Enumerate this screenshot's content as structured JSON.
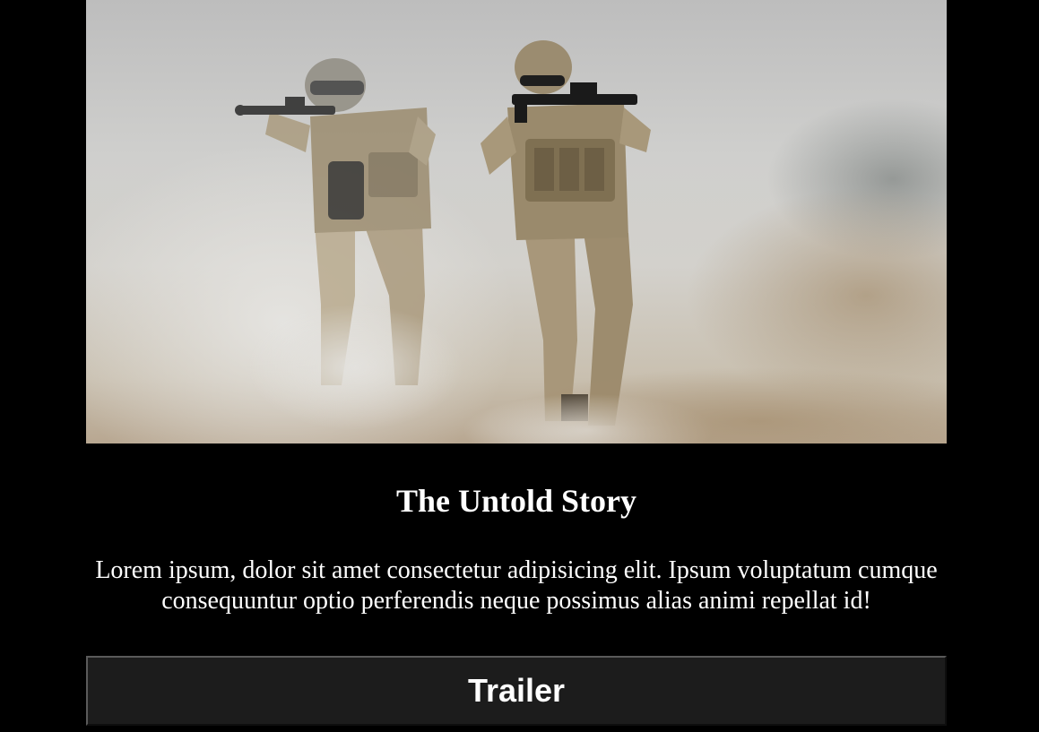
{
  "hero": {
    "image_subject": "two-soldiers-in-smoke-photo"
  },
  "title": "The Untold Story",
  "description": "Lorem ipsum, dolor sit amet consectetur adipisicing elit. Ipsum voluptatum cumque consequuntur optio perferendis neque possimus alias animi repellat id!",
  "trailer_button": {
    "label": "Trailer"
  },
  "colors": {
    "page_background": "#000000",
    "text": "#ffffff",
    "button_background": "#1c1c1c"
  }
}
